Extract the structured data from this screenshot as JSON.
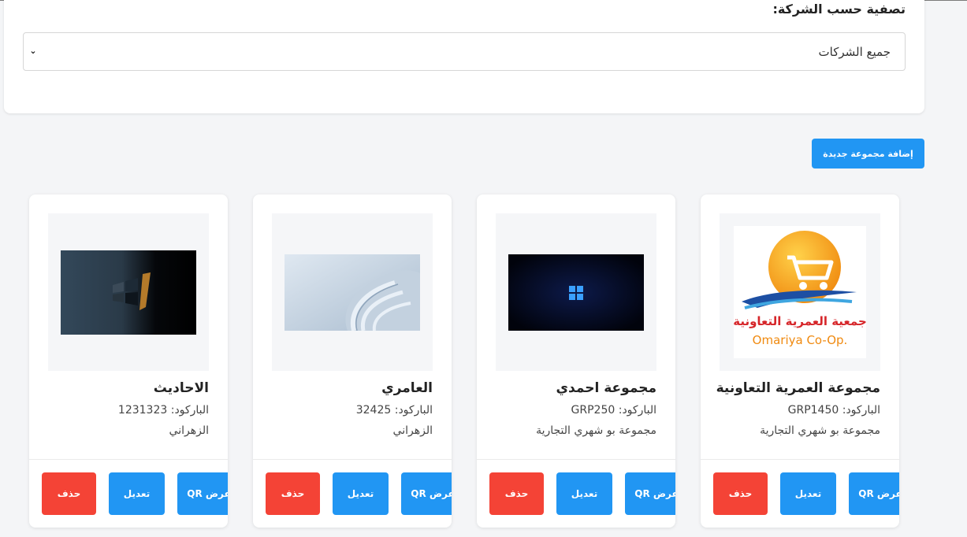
{
  "filter": {
    "label": "تصفية حسب الشركة:",
    "selected": "جميع الشركات",
    "chevron": "chevron-down-icon"
  },
  "toolbar": {
    "add_group_label": "إضافة مجموعة جديدة"
  },
  "colors": {
    "primary": "#2196f3",
    "danger": "#f44336",
    "card_bg": "#ffffff",
    "page_bg": "#f4f5f7"
  },
  "groups": [
    {
      "name": "مجموعة العمرية التعاونية",
      "barcode": "الباركود: GRP1450",
      "company": "مجموعة بو شهري التجارية",
      "image": "omariya-coop-logo",
      "logo_text_ar": "جمعية العمرية التعاونية",
      "logo_text_en": "Omariya Co-Op.",
      "view_qr": "عرض QR",
      "edit": "تعديل",
      "delete": "حذف"
    },
    {
      "name": "مجموعة احمدي",
      "barcode": "الباركود: GRP250",
      "company": "مجموعة بو شهري التجارية",
      "image": "windows-11-wallpaper",
      "view_qr": "عرض QR",
      "edit": "تعديل",
      "delete": "حذف"
    },
    {
      "name": "العامري",
      "barcode": "الباركود: 32425",
      "company": "الزهراني",
      "image": "abstract-ribbon-wallpaper",
      "view_qr": "عرض QR",
      "edit": "تعديل",
      "delete": "حذف"
    },
    {
      "name": "الاحاديث",
      "barcode": "الباركود: 1231323",
      "company": "الزهراني",
      "image": "windows-7-wallpaper",
      "view_qr": "عرض QR",
      "edit": "تعديل",
      "delete": "حذف"
    }
  ]
}
